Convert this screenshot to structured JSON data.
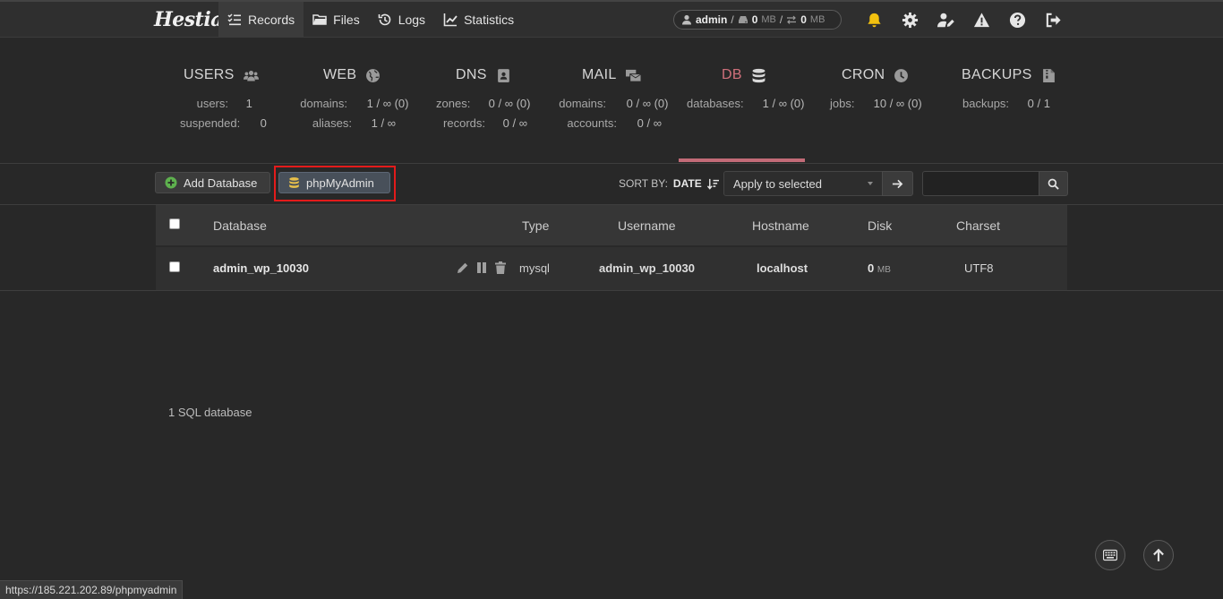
{
  "app": {
    "logo_text": "Hestia"
  },
  "nav": [
    {
      "label": "Records",
      "icon": "list-check-icon",
      "active": true
    },
    {
      "label": "Files",
      "icon": "folder-icon"
    },
    {
      "label": "Logs",
      "icon": "history-icon"
    },
    {
      "label": "Statistics",
      "icon": "chart-line-icon"
    }
  ],
  "user": {
    "name": "admin",
    "sep1": "/",
    "disk_value": "0",
    "disk_unit": "MB",
    "sep2": "/",
    "bw_value": "0",
    "bw_unit": "MB"
  },
  "top_icons": [
    "bell-icon",
    "gear-icon",
    "user-edit-icon",
    "warning-icon",
    "help-icon",
    "logout-icon"
  ],
  "colors": {
    "accent_db": "#d0707b",
    "bell": "#f2c10f",
    "highlight": "#e31b1b",
    "add_icon": "#5eb14e",
    "db_icon": "#e8c04a"
  },
  "stats": {
    "users": {
      "title": "USERS",
      "r1_label": "users:",
      "r1_value": "1",
      "r2_label": "suspended:",
      "r2_value": "0"
    },
    "web": {
      "title": "WEB",
      "r1_label": "domains:",
      "r1_value": "1 / ∞ (0)",
      "r2_label": "aliases:",
      "r2_value": "1 / ∞"
    },
    "dns": {
      "title": "DNS",
      "r1_label": "zones:",
      "r1_value": "0 / ∞ (0)",
      "r2_label": "records:",
      "r2_value": "0 / ∞"
    },
    "mail": {
      "title": "MAIL",
      "r1_label": "domains:",
      "r1_value": "0 / ∞ (0)",
      "r2_label": "accounts:",
      "r2_value": "0 / ∞"
    },
    "db": {
      "title": "DB",
      "r1_label": "databases:",
      "r1_value": "1 / ∞ (0)"
    },
    "cron": {
      "title": "CRON",
      "r1_label": "jobs:",
      "r1_value": "10 / ∞ (0)"
    },
    "backups": {
      "title": "BACKUPS",
      "r1_label": "backups:",
      "r1_value": "0 / 1"
    }
  },
  "toolbar": {
    "add_label": "Add Database",
    "pma_label": "phpMyAdmin",
    "sort_label": "SORT BY:",
    "sort_value": "DATE",
    "bulk_selected": "Apply to selected",
    "search_value": ""
  },
  "table": {
    "headers": {
      "database": "Database",
      "type": "Type",
      "username": "Username",
      "hostname": "Hostname",
      "disk": "Disk",
      "charset": "Charset"
    },
    "rows": [
      {
        "database": "admin_wp_10030",
        "type": "mysql",
        "username": "admin_wp_10030",
        "hostname": "localhost",
        "disk_value": "0",
        "disk_unit": "MB",
        "charset": "UTF8"
      }
    ]
  },
  "footer": {
    "count_text": "1 SQL database"
  },
  "status_url": "https://185.221.202.89/phpmyadmin"
}
